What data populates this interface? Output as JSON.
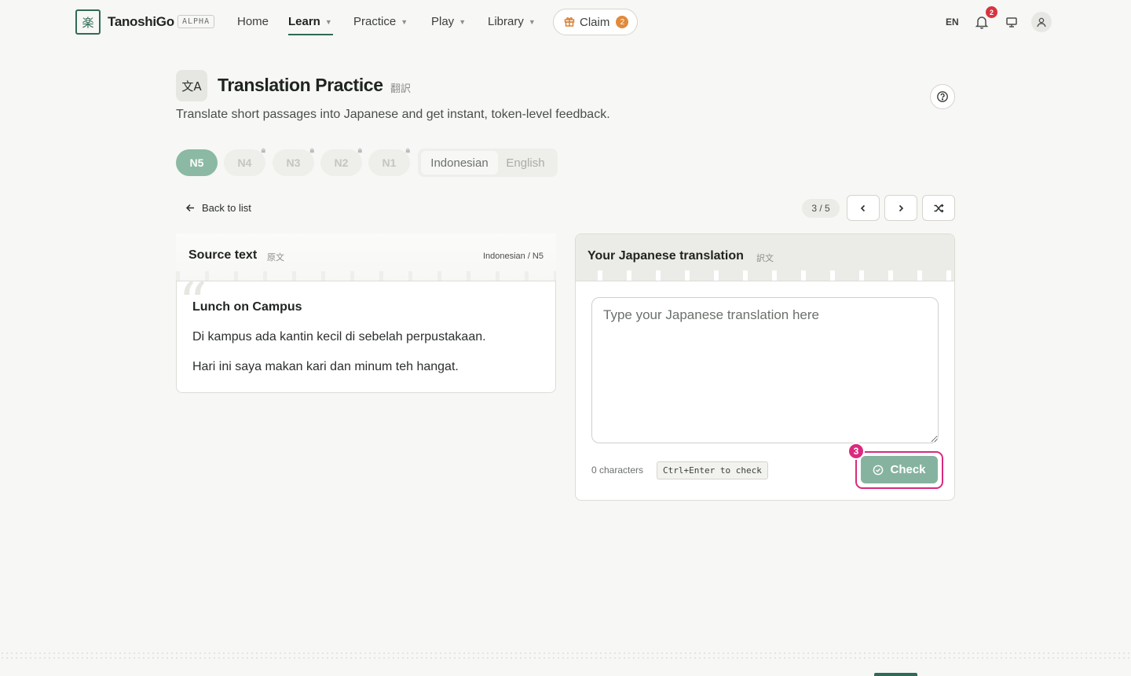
{
  "header": {
    "brand": "TanoshiGo",
    "brand_icon": "楽",
    "badge": "ALPHA",
    "nav": [
      {
        "label": "Home"
      },
      {
        "label": "Learn"
      },
      {
        "label": "Practice"
      },
      {
        "label": "Play"
      },
      {
        "label": "Library"
      }
    ],
    "active_nav": "Learn",
    "claim": {
      "label": "Claim",
      "count": "2"
    },
    "language": "EN",
    "notification_count": "2"
  },
  "page": {
    "icon": "文A",
    "title": "Translation Practice",
    "title_jp": "翻訳",
    "subtitle": "Translate short passages into Japanese and get instant, token-level feedback."
  },
  "levels": [
    {
      "label": "N5",
      "locked": false,
      "active": true
    },
    {
      "label": "N4",
      "locked": true
    },
    {
      "label": "N3",
      "locked": true
    },
    {
      "label": "N2",
      "locked": true
    },
    {
      "label": "N1",
      "locked": true
    }
  ],
  "source_languages": {
    "options": [
      "Indonesian",
      "English"
    ],
    "selected": "Indonesian"
  },
  "toolbar": {
    "back_label": "Back to list",
    "pager": "3 / 5"
  },
  "source_card": {
    "title": "Source text",
    "title_jp": "原文",
    "meta": "Indonesian / N5",
    "passage_title": "Lunch on Campus",
    "lines": [
      "Di kampus ada kantin kecil di sebelah perpustakaan.",
      "Hari ini saya makan kari dan minum teh hangat."
    ]
  },
  "translation_card": {
    "title": "Your Japanese translation",
    "title_jp": "訳文",
    "placeholder": "Type your Japanese translation here",
    "value": "",
    "char_count": "0 characters",
    "shortcut": "Ctrl+Enter to check",
    "check_label": "Check"
  },
  "tutorial_step": "3",
  "colors": {
    "brand": "#2f6b57",
    "level_active": "#8bb9a3",
    "check_button": "#86b3a0",
    "highlight": "#d92a7d",
    "notification": "#d8343f",
    "claim_badge": "#e08a3c"
  }
}
